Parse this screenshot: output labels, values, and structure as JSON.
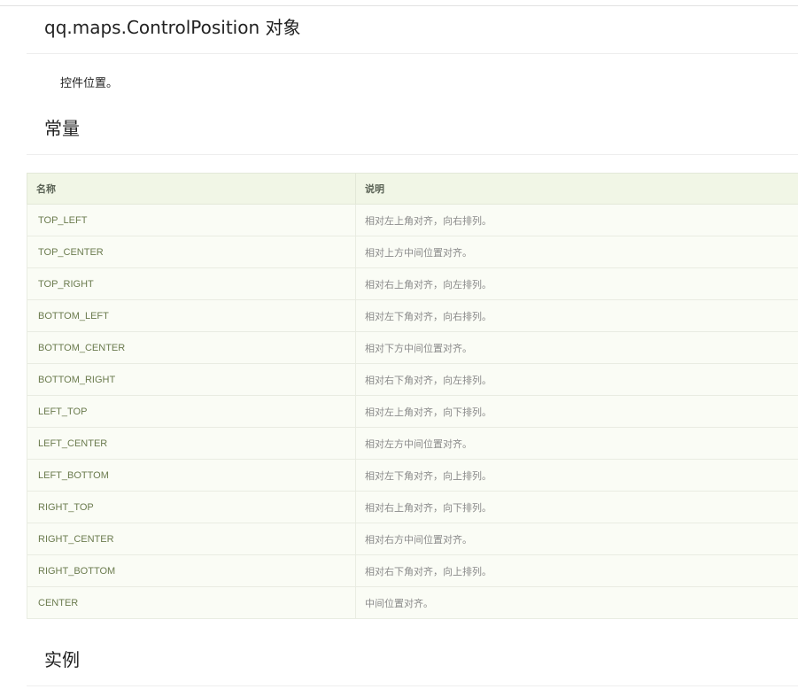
{
  "page": {
    "title": "qq.maps.ControlPosition 对象",
    "description": "控件位置。"
  },
  "sections": {
    "constants_heading": "常量",
    "example_heading": "实例"
  },
  "table": {
    "headers": [
      "名称",
      "说明"
    ],
    "rows": [
      {
        "name": "TOP_LEFT",
        "desc": "相对左上角对齐，向右排列。"
      },
      {
        "name": "TOP_CENTER",
        "desc": "相对上方中间位置对齐。"
      },
      {
        "name": "TOP_RIGHT",
        "desc": "相对右上角对齐，向左排列。"
      },
      {
        "name": "BOTTOM_LEFT",
        "desc": "相对左下角对齐，向右排列。"
      },
      {
        "name": "BOTTOM_CENTER",
        "desc": "相对下方中间位置对齐。"
      },
      {
        "name": "BOTTOM_RIGHT",
        "desc": "相对右下角对齐，向左排列。"
      },
      {
        "name": "LEFT_TOP",
        "desc": "相对左上角对齐，向下排列。"
      },
      {
        "name": "LEFT_CENTER",
        "desc": "相对左方中间位置对齐。"
      },
      {
        "name": "LEFT_BOTTOM",
        "desc": "相对左下角对齐，向上排列。"
      },
      {
        "name": "RIGHT_TOP",
        "desc": "相对右上角对齐，向下排列。"
      },
      {
        "name": "RIGHT_CENTER",
        "desc": "相对右方中间位置对齐。"
      },
      {
        "name": "RIGHT_BOTTOM",
        "desc": "相对右下角对齐，向上排列。"
      },
      {
        "name": "CENTER",
        "desc": "中间位置对齐。"
      }
    ]
  },
  "colors": {
    "header_bg": "#f1f6e6",
    "row_bg": "#fafcf5",
    "name_text": "#6b7b4e",
    "desc_text": "#8a8a8a"
  }
}
